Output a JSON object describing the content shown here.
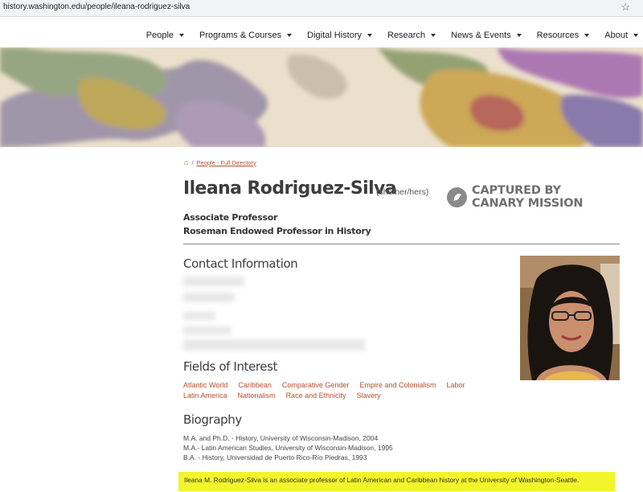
{
  "browser": {
    "url": "history.washington.edu/people/ileana-rodriguez-silva"
  },
  "nav": {
    "items": [
      {
        "label": "People"
      },
      {
        "label": "Programs & Courses"
      },
      {
        "label": "Digital History"
      },
      {
        "label": "Research"
      },
      {
        "label": "News & Events"
      },
      {
        "label": "Resources"
      },
      {
        "label": "About"
      }
    ]
  },
  "breadcrumb": {
    "link": "People - Full Directory"
  },
  "profile": {
    "name": "Ileana Rodriguez-Silva",
    "pronouns": "(she/her/hers)",
    "titles": [
      "Associate Professor",
      "Roseman Endowed Professor in History"
    ]
  },
  "watermark": {
    "line1": "CAPTURED BY",
    "line2": "CANARY MISSION"
  },
  "sections": {
    "contact": "Contact Information",
    "fields": "Fields of Interest",
    "biography": "Biography"
  },
  "fields": [
    "Atlantic World",
    "Caribbean",
    "Comparative Gender",
    "Empire and Colonialism",
    "Labor",
    "Latin America",
    "Nationalism",
    "Race and Ethnicity",
    "Slavery"
  ],
  "biography": {
    "degrees": [
      "M.A. and Ph.D. - History, University of Wisconsin-Madison, 2004",
      "M.A.- Latin American Studies, University of Wisconsin-Madison, 1995",
      "B.A. - History, Universidad de Puerto Rico-Río Piedras, 1993"
    ],
    "summary": "Ileana M. Rodriguez-Silva is an associate professor of Latin American and Caribbean history at the University of Washington-Seattle."
  },
  "colors": {
    "link": "#b5502d",
    "highlight": "#f2f52a"
  }
}
